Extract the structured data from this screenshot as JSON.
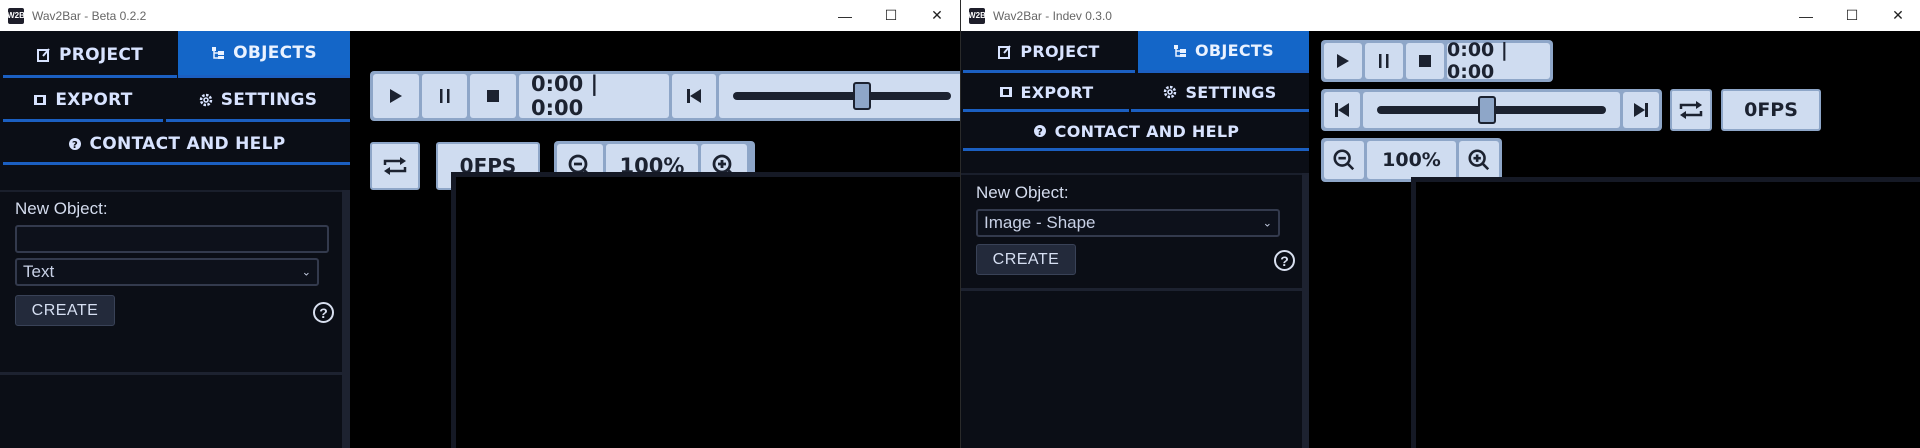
{
  "left": {
    "title": "Wav2Bar - Beta 0.2.2",
    "logo": "W2B",
    "tabs": {
      "project": "PROJECT",
      "objects": "OBJECTS",
      "export": "EXPORT",
      "settings": "SETTINGS",
      "contact": "CONTACT AND HELP"
    },
    "new_object_label": "New Object:",
    "name_input_value": "",
    "type_select_value": "Text",
    "create_label": "CREATE",
    "help_glyph": "?",
    "time_display": "0:00 | 0:00",
    "fps": "0FPS",
    "zoom": "100%",
    "slider_position": 0.6
  },
  "right": {
    "title": "Wav2Bar - Indev 0.3.0",
    "logo": "W2B",
    "tabs": {
      "project": "PROJECT",
      "objects": "OBJECTS",
      "export": "EXPORT",
      "settings": "SETTINGS",
      "contact": "CONTACT AND HELP"
    },
    "new_object_label": "New Object:",
    "type_select_value": "Image - Shape",
    "create_label": "CREATE",
    "help_glyph": "?",
    "time_display": "0:00 | 0:00",
    "fps": "0FPS",
    "zoom": "100%",
    "slider_position": 0.48
  },
  "window_controls": {
    "minimize": "—",
    "maximize": "☐",
    "close": "✕"
  },
  "colors": {
    "accent": "#1466c8",
    "control_bg": "#cfdcf0",
    "control_frame": "#8ea6c8",
    "panel_bg": "#0b0e16"
  },
  "icons": [
    "play-icon",
    "pause-icon",
    "stop-icon",
    "skip-back-icon",
    "skip-forward-icon",
    "loop-icon",
    "zoom-out-icon",
    "zoom-in-icon",
    "help-icon",
    "project-icon",
    "objects-icon",
    "export-icon",
    "settings-icon"
  ]
}
